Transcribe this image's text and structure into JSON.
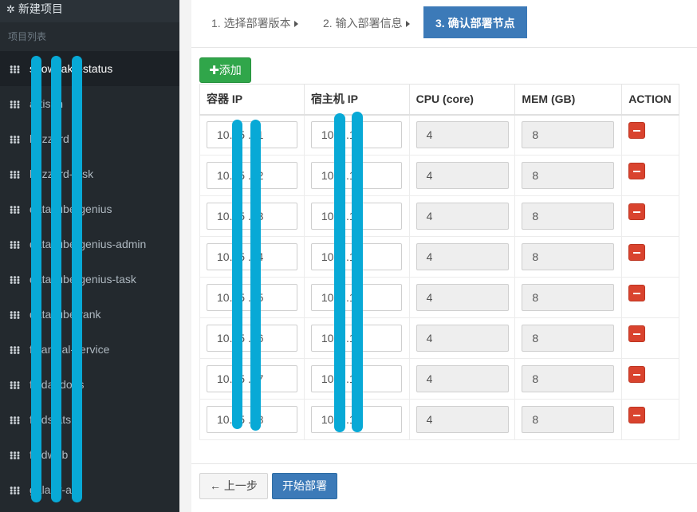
{
  "sidebar": {
    "new_project": "新建项目",
    "section_title": "项目列表",
    "items": [
      {
        "label": "snowflake-status",
        "active": true
      },
      {
        "label": "artisan"
      },
      {
        "label": "buzzard"
      },
      {
        "label": "buzzard-task"
      },
      {
        "label": "datacube-genius"
      },
      {
        "label": "datacube-genius-admin"
      },
      {
        "label": "datacube-genius-task"
      },
      {
        "label": "datacube-rank"
      },
      {
        "label": "financial-service"
      },
      {
        "label": "findaddons"
      },
      {
        "label": "findstats"
      },
      {
        "label": "findweb"
      },
      {
        "label": "galaxy-api"
      }
    ]
  },
  "wizard": {
    "step1": "1. 选择部署版本",
    "step2": "2. 输入部署信息",
    "step3": "3. 确认部署节点"
  },
  "add_button": "添加",
  "table": {
    "headers": [
      "容器 IP",
      "宿主机 IP",
      "CPU (core)",
      "MEM (GB)",
      "ACTION"
    ],
    "rows": [
      {
        "container_ip": "10.   .5   .21",
        "host_ip": "10.   .   .12",
        "cpu": "4",
        "mem": "8"
      },
      {
        "container_ip": "10.   .5   .22",
        "host_ip": "10.   .   .13",
        "cpu": "4",
        "mem": "8"
      },
      {
        "container_ip": "10.   .5   .23",
        "host_ip": "10.   .   .14",
        "cpu": "4",
        "mem": "8"
      },
      {
        "container_ip": "10.   .5   .24",
        "host_ip": "10.   .   .15",
        "cpu": "4",
        "mem": "8"
      },
      {
        "container_ip": "10.   .5   .25",
        "host_ip": "10.   .   .12",
        "cpu": "4",
        "mem": "8"
      },
      {
        "container_ip": "10.   .5   .26",
        "host_ip": "10.   .   .13",
        "cpu": "4",
        "mem": "8"
      },
      {
        "container_ip": "10.   .5   .27",
        "host_ip": "10.   .   .14",
        "cpu": "4",
        "mem": "8"
      },
      {
        "container_ip": "10.   .5   .28",
        "host_ip": "10.   .   .15",
        "cpu": "4",
        "mem": "8"
      }
    ]
  },
  "footer": {
    "prev": "← 上一步",
    "start": "开始部署"
  },
  "colors": {
    "sidebar_bg": "#23292e",
    "primary": "#3c7ab8",
    "success": "#30a64a",
    "danger": "#d9432e",
    "redaction": "#08a9d6"
  }
}
